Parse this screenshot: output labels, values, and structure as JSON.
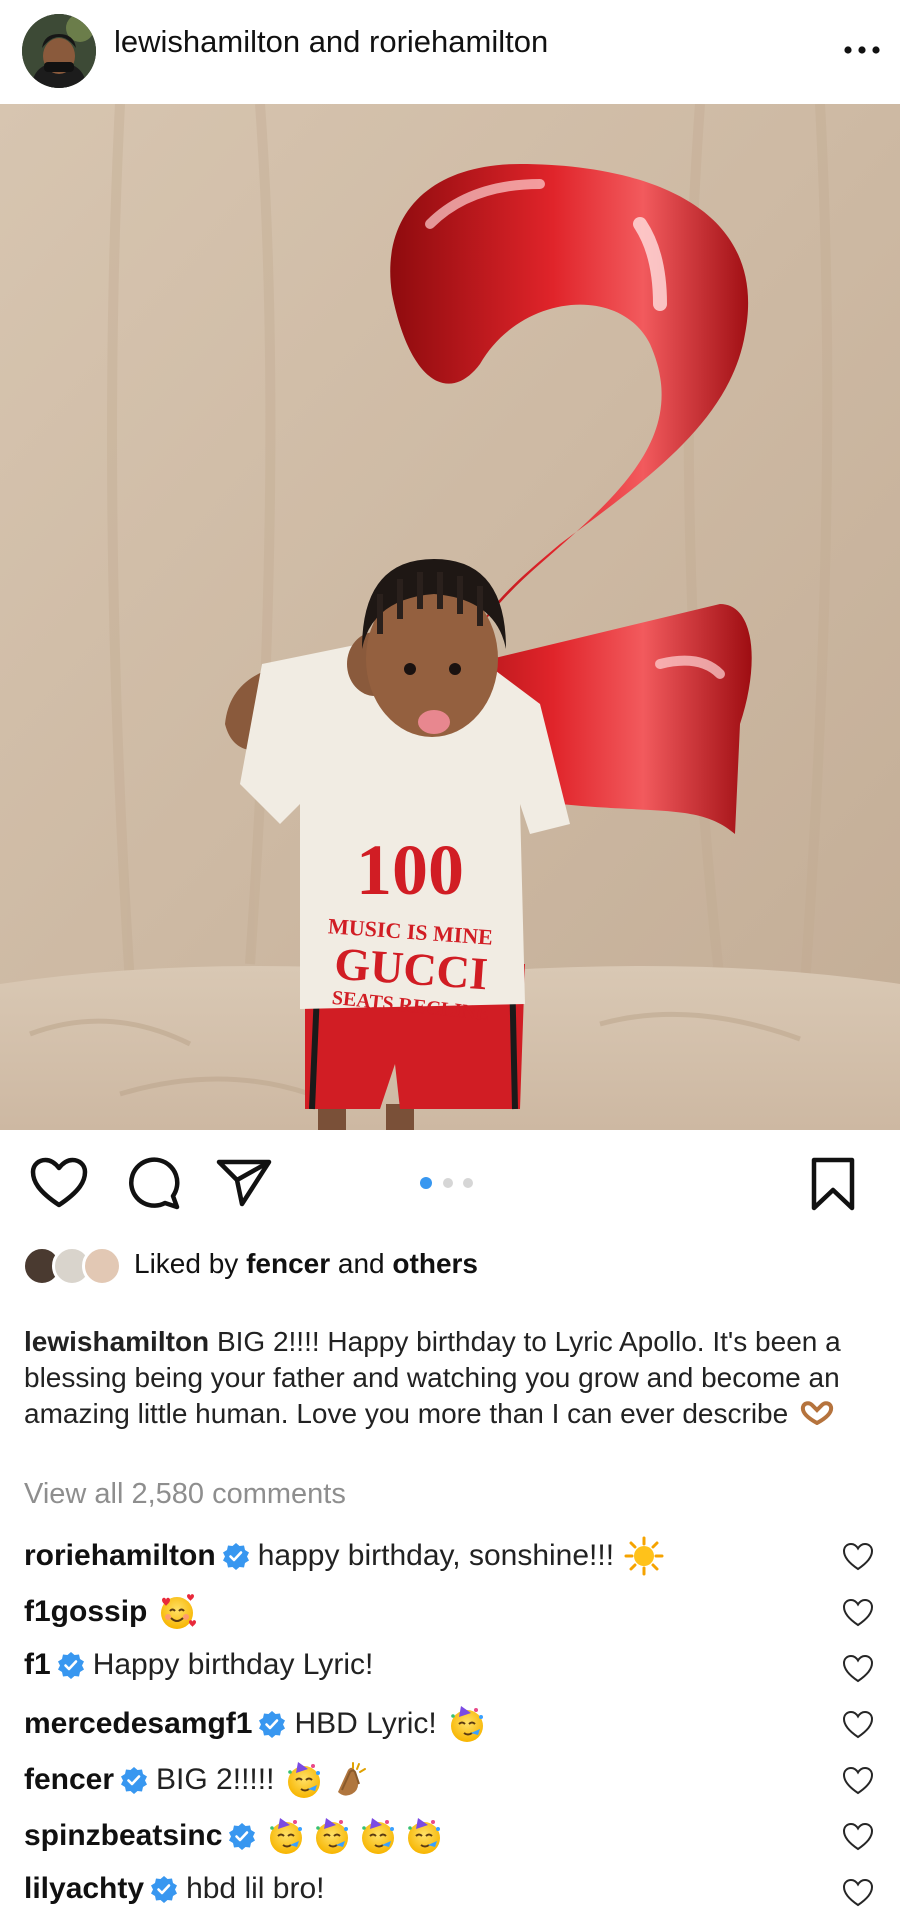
{
  "header": {
    "title": "lewishamilton and roriehamilton",
    "avatar_icon": "profile-avatar",
    "more_icon": "more-horizontal-icon"
  },
  "photo": {
    "balloon_number": "2",
    "shirt_lines": [
      "100",
      "MUSIC IS MINE",
      "GUCCI",
      "SEATS RECLINE"
    ],
    "balloon_color": "#d0161b"
  },
  "actions": {
    "like_icon": "heart-icon",
    "comment_icon": "comment-bubble-icon",
    "share_icon": "paper-plane-icon",
    "save_icon": "bookmark-icon",
    "carousel": {
      "count": 3,
      "active": 0,
      "active_color": "#3897f0",
      "inactive_color": "#d6d6d6"
    }
  },
  "likes": {
    "prefix": "Liked by ",
    "user": "fencer",
    "middle": " and ",
    "others": "others"
  },
  "caption": {
    "user": "lewishamilton",
    "text": "BIG 2!!!! Happy birthday to Lyric Apollo. It's been a blessing being your father and watching you grow and become an amazing little human. Love you more than I can ever describe",
    "emoji": "heart-hands"
  },
  "view_all": "View all 2,580 comments",
  "verified_color": "#3897f0",
  "comments": [
    {
      "user": "roriehamilton",
      "verified": true,
      "text": "happy birthday, sonshine!!!",
      "emojis": [
        "sun"
      ]
    },
    {
      "user": "f1gossip",
      "verified": false,
      "text": "",
      "emojis": [
        "smiling-face-with-hearts"
      ]
    },
    {
      "user": "f1",
      "verified": true,
      "text": "Happy birthday Lyric!",
      "emojis": []
    },
    {
      "user": "mercedesamgf1",
      "verified": true,
      "text": "HBD Lyric!",
      "emojis": [
        "partying-face"
      ]
    },
    {
      "user": "fencer",
      "verified": true,
      "text": "BIG 2!!!!!",
      "emojis": [
        "partying-face",
        "clapping-hands"
      ]
    },
    {
      "user": "spinzbeatsinc",
      "verified": true,
      "text": "",
      "emojis": [
        "partying-face",
        "partying-face",
        "partying-face",
        "partying-face"
      ]
    },
    {
      "user": "lilyachty",
      "verified": true,
      "text": "hbd lil bro!",
      "emojis": []
    }
  ]
}
